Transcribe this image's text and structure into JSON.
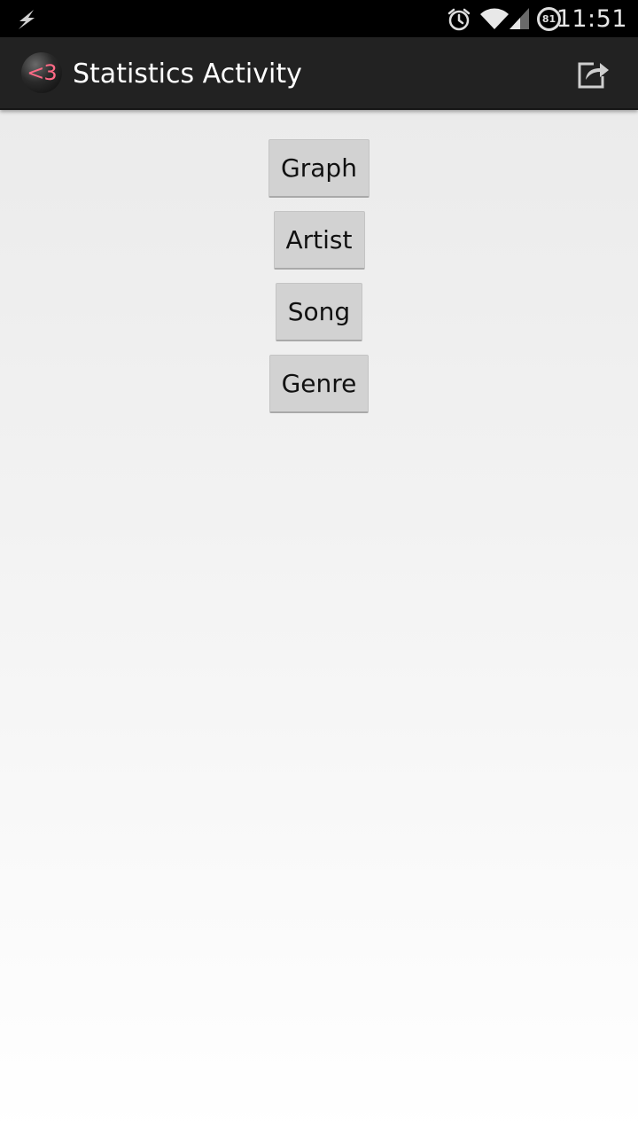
{
  "status_bar": {
    "time": "11:51",
    "battery_level": "81",
    "icons": [
      "flash-icon",
      "alarm-icon",
      "wifi-icon",
      "signal-icon",
      "battery-icon"
    ]
  },
  "action_bar": {
    "app_icon_text": "<3",
    "title": "Statistics Activity",
    "share_icon": "share-icon"
  },
  "buttons": [
    {
      "label": "Graph"
    },
    {
      "label": "Artist"
    },
    {
      "label": "Song"
    },
    {
      "label": "Genre"
    }
  ],
  "colors": {
    "status_bar_bg": "#000000",
    "action_bar_bg": "#222222",
    "app_icon_accent": "#ff6a86",
    "button_bg": "#d2d2d2"
  }
}
